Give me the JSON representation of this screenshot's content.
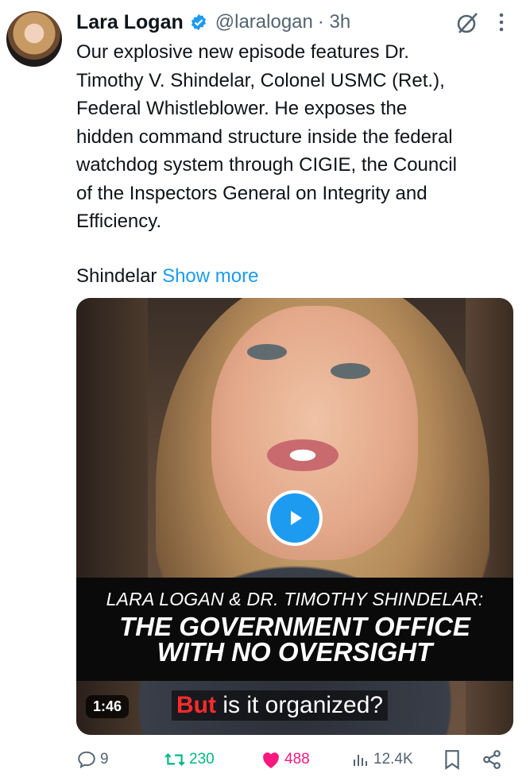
{
  "tweet": {
    "author_name": "Lara Logan",
    "handle": "@laralogan",
    "time": "· 3h",
    "text": "Our explosive new episode features Dr.\nTimothy V. Shindelar, Colonel USMC (Ret.),\nFederal Whistleblower. He exposes the\nhidden command structure inside the federal\nwatchdog system through CIGIE, the Council\nof the Inspectors General on Integrity and\nEfficiency.",
    "text_tail": "Shindelar",
    "show_more": "Show more"
  },
  "media": {
    "banner_line1": "LARA LOGAN & DR. TIMOTHY SHINDELAR:",
    "banner_line2": "THE GOVERNMENT OFFICE",
    "banner_line3": "WITH NO OVERSIGHT",
    "duration": "1:46",
    "caption_highlight": "But",
    "caption_rest": " is it organized?"
  },
  "actions": {
    "replies": "9",
    "retweets": "230",
    "likes": "488",
    "views": "12.4K"
  },
  "colors": {
    "accent": "#1d9bf0",
    "retweet": "#00ba7c",
    "like": "#f91880",
    "muted": "#536471"
  }
}
